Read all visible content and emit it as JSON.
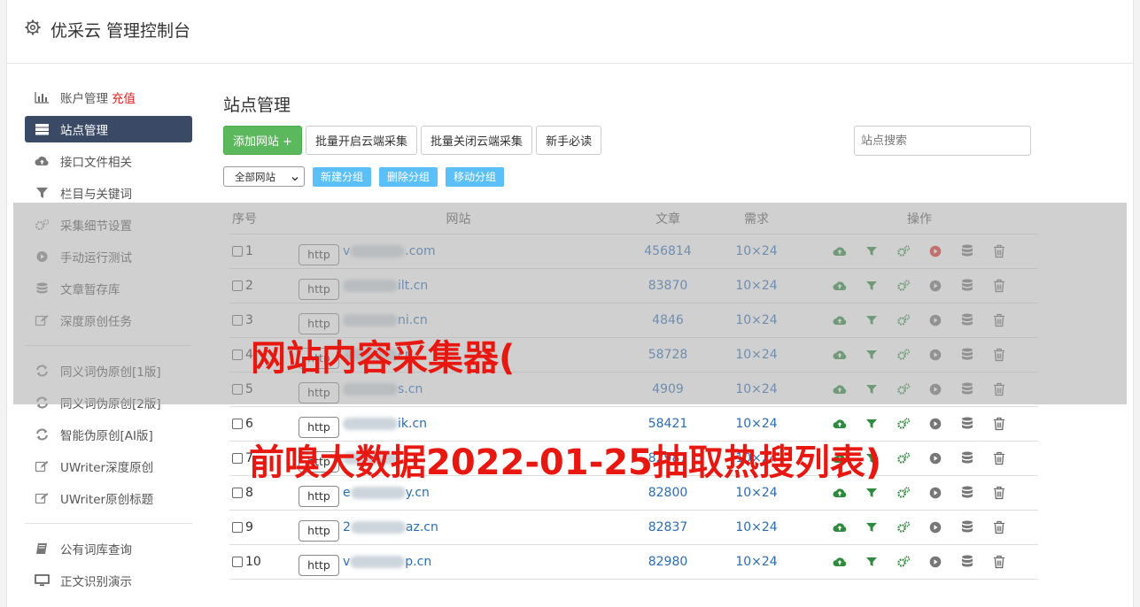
{
  "header": {
    "title": "优采云 管理控制台"
  },
  "sidebar": {
    "items": [
      {
        "label": "账户管理",
        "extra": "充值",
        "icon": "bar-chart-icon"
      },
      {
        "label": "站点管理",
        "icon": "server-icon",
        "active": true
      },
      {
        "label": "接口文件相关",
        "icon": "cloud-upload-icon"
      },
      {
        "label": "栏目与关键词",
        "icon": "filter-icon"
      },
      {
        "label": "采集细节设置",
        "icon": "gears-icon"
      },
      {
        "label": "手动运行测试",
        "icon": "play-circle-icon"
      },
      {
        "label": "文章暂存库",
        "icon": "database-icon"
      },
      {
        "label": "深度原创任务",
        "icon": "edit-icon"
      }
    ],
    "items2": [
      {
        "label": "同义词伪原创[1版]",
        "icon": "refresh-icon"
      },
      {
        "label": "同义词伪原创[2版]",
        "icon": "refresh-icon"
      },
      {
        "label": "智能伪原创[AI版]",
        "icon": "refresh-icon"
      },
      {
        "label": "UWriter深度原创",
        "icon": "edit-icon"
      },
      {
        "label": "UWriter原创标题",
        "icon": "edit-icon"
      }
    ],
    "items3": [
      {
        "label": "公有词库查询",
        "icon": "book-icon"
      },
      {
        "label": "正文识别演示",
        "icon": "monitor-icon"
      }
    ]
  },
  "main": {
    "title": "站点管理",
    "toolbar": {
      "add_site": "添加网站 +",
      "batch_open": "批量开启云端采集",
      "batch_close": "批量关闭云端采集",
      "guide": "新手必读"
    },
    "search_placeholder": "站点搜索",
    "group_select": "全部网站",
    "new_group": "新建分组",
    "delete_group": "删除分组",
    "move_group": "移动分组",
    "columns": [
      "序号",
      "网站",
      "文章",
      "需求",
      "操作"
    ],
    "rows": [
      {
        "no": "1",
        "proto": "http",
        "prefix": "v",
        "suffix": ".com",
        "articles": "456814",
        "need": "10×24",
        "running": true
      },
      {
        "no": "2",
        "proto": "http",
        "prefix": "",
        "suffix": "ilt.cn",
        "articles": "83870",
        "need": "10×24"
      },
      {
        "no": "3",
        "proto": "http",
        "prefix": "",
        "suffix": "ni.cn",
        "articles": "4846",
        "need": "10×24"
      },
      {
        "no": "4",
        "proto": "http",
        "prefix": "",
        "suffix": "cn",
        "articles": "58728",
        "need": "10×24"
      },
      {
        "no": "5",
        "proto": "http",
        "prefix": "",
        "suffix": "s.cn",
        "articles": "4909",
        "need": "10×24"
      },
      {
        "no": "6",
        "proto": "http",
        "prefix": "",
        "suffix": "ik.cn",
        "articles": "58421",
        "need": "10×24"
      },
      {
        "no": "7",
        "proto": "http",
        "prefix": "",
        "suffix": "",
        "articles": "82987",
        "need": "10×24"
      },
      {
        "no": "8",
        "proto": "http",
        "prefix": "e",
        "suffix": "y.cn",
        "articles": "82800",
        "need": "10×24"
      },
      {
        "no": "9",
        "proto": "http",
        "prefix": "2",
        "suffix": "az.cn",
        "articles": "82837",
        "need": "10×24"
      },
      {
        "no": "10",
        "proto": "http",
        "prefix": "v",
        "suffix": "p.cn",
        "articles": "82980",
        "need": "10×24"
      }
    ]
  },
  "watermark": {
    "line1": "网站内容采集器(",
    "line2": "前嗅大数据2022-01-25抽取热搜列表)"
  },
  "colors": {
    "green": "#5cb85c",
    "active_nav": "#3a4a66",
    "link": "#2a6cb5",
    "watermark": "#e8170f",
    "light_blue": "#5bc0f8"
  }
}
